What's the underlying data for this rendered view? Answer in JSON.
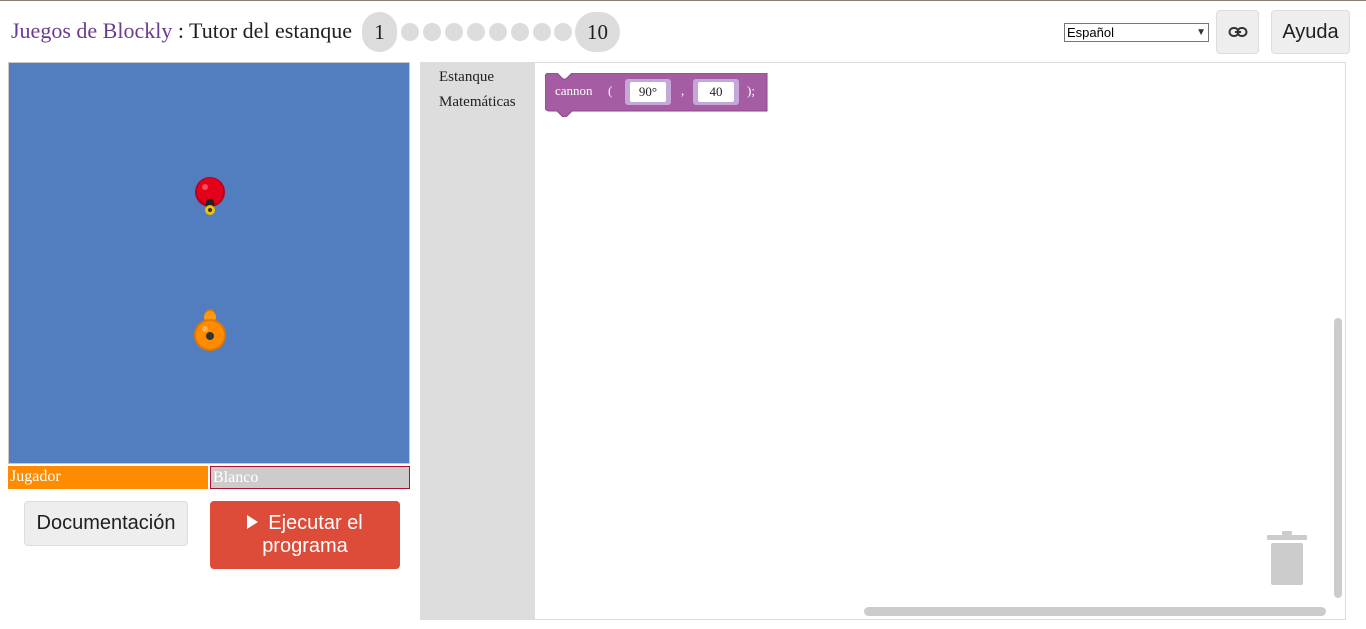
{
  "header": {
    "brand": "Juegos de Blockly",
    "separator": " : ",
    "app_name": "Tutor del estanque",
    "levels": {
      "first": "1",
      "last": "10",
      "dots_count": 8
    },
    "language": {
      "selected": "Español"
    },
    "link_icon": "link-icon",
    "help_label": "Ayuda"
  },
  "pond": {
    "background": "#527dbf",
    "ducks": [
      {
        "name": "red-duck",
        "color": "#e3001b"
      },
      {
        "name": "orange-duck",
        "color": "#ff8c00"
      }
    ]
  },
  "health_bars": {
    "player_label": "Jugador",
    "player_color": "#ff8c00",
    "target_label": "Blanco",
    "target_color": "#cccccc"
  },
  "buttons": {
    "documentation": "Documentación",
    "run": "Ejecutar el programa",
    "run_color": "#dd4b39"
  },
  "toolbox": {
    "items": [
      "Estanque",
      "Matemáticas"
    ]
  },
  "workspace": {
    "block": {
      "color": "#a55ca3",
      "function": "cannon",
      "open_paren": "(",
      "angle": "90°",
      "comma": ",",
      "range": "40",
      "close": ");"
    },
    "trash_icon": "trash-icon"
  }
}
